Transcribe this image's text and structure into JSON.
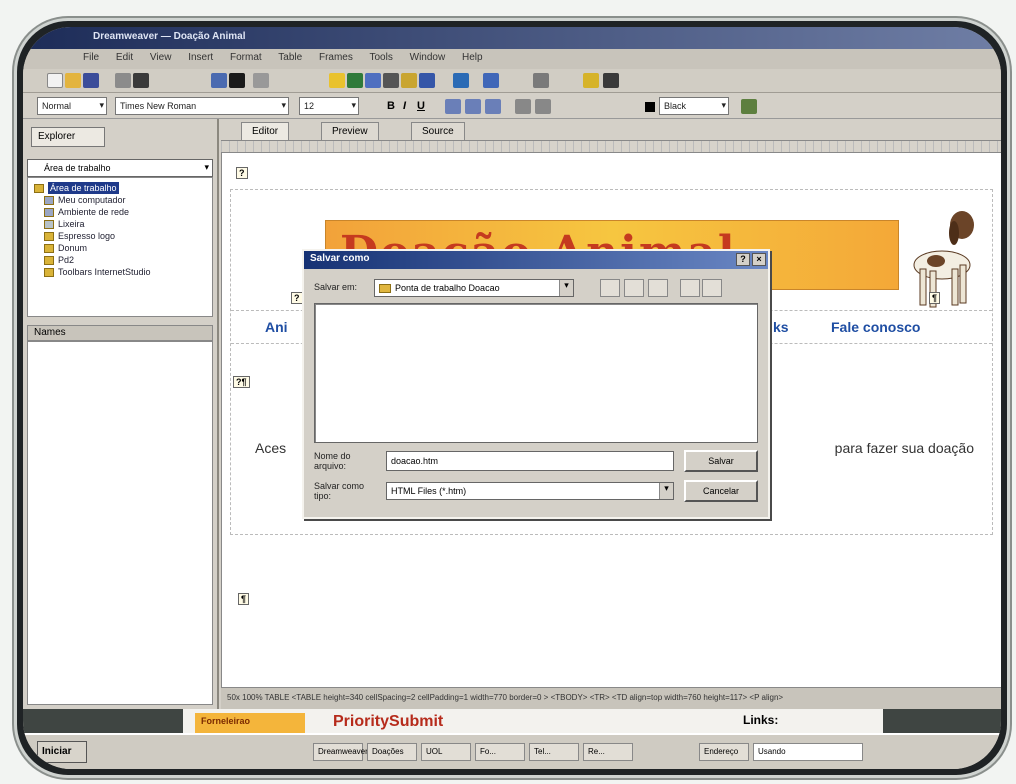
{
  "window": {
    "title": "Dreamweaver — Doação Animal"
  },
  "menu": [
    "File",
    "Edit",
    "View",
    "Insert",
    "Format",
    "Table",
    "Frames",
    "Tools",
    "Window",
    "Help"
  ],
  "toolbar": {
    "style_value": "Normal",
    "font_value": "Times New Roman",
    "size_value": "12",
    "bold": "B",
    "italic": "I",
    "underline": "U",
    "color_value": "Black"
  },
  "explorer": {
    "tab_label": "Explorer",
    "location": "Área de trabalho",
    "tree": [
      {
        "label": "Área de trabalho",
        "selected": true
      },
      {
        "label": "Meu computador",
        "selected": false
      },
      {
        "label": "Ambiente de rede",
        "selected": false
      },
      {
        "label": "Lixeira",
        "selected": false
      },
      {
        "label": "Espresso logo",
        "selected": false
      },
      {
        "label": "Donum",
        "selected": false
      },
      {
        "label": "Pd2",
        "selected": false
      },
      {
        "label": "Toolbars InternetStudio",
        "selected": false
      }
    ],
    "names_label": "Names"
  },
  "editor": {
    "tabs": [
      "Editor",
      "Preview",
      "Source"
    ],
    "banner_text": "Doação Animal",
    "nav_links": [
      "Ani",
      "ks",
      "Fale conosco"
    ],
    "body_left": "Aces",
    "body_right": "para fazer sua doação"
  },
  "statusbar": {
    "text": "50x 100%   TABLE   <TABLE height=340 cellSpacing=2 cellPadding=1 width=770 border=0 > <TBODY> <TR> <TD align=top width=760 height=117> <P align>"
  },
  "lower_strip": {
    "tab_label": "Forneleirao",
    "brand": "PrioritySubmit",
    "links_label": "Links:"
  },
  "taskbar": {
    "start": "Iniciar",
    "items": [
      "Dreamweaver",
      "Doações",
      "UOL",
      "Fo...",
      "Tel...",
      "Re..."
    ],
    "address_label": "Endereço",
    "address_value": "Usando"
  },
  "save_dialog": {
    "title": "Salvar como",
    "save_in_label": "Salvar em:",
    "save_in_value": "Ponta de trabalho Doacao",
    "filename_label": "Nome do arquivo:",
    "filename_value": "doacao.htm",
    "filetype_label": "Salvar como tipo:",
    "filetype_value": "HTML Files (*.htm)",
    "save_button": "Salvar",
    "cancel_button": "Cancelar"
  }
}
